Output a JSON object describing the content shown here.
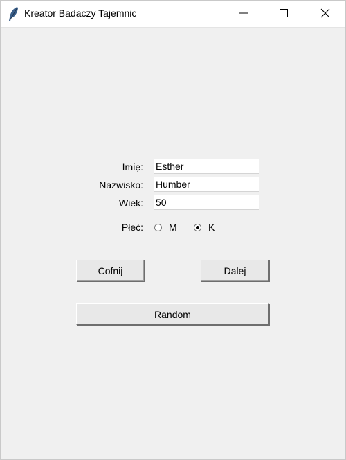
{
  "window": {
    "title": "Kreator Badaczy Tajemnic",
    "controls": {
      "minimize": "minimize",
      "maximize": "maximize",
      "close": "close"
    }
  },
  "form": {
    "first_name": {
      "label": "Imię:",
      "value": "Esther"
    },
    "last_name": {
      "label": "Nazwisko:",
      "value": "Humber"
    },
    "age": {
      "label": "Wiek:",
      "value": "50"
    },
    "sex": {
      "label": "Płeć:",
      "options": [
        {
          "label": "M",
          "selected": false
        },
        {
          "label": "K",
          "selected": true
        }
      ]
    }
  },
  "buttons": {
    "back": "Cofnij",
    "next": "Dalej",
    "random": "Random"
  },
  "icons": {
    "app": "feather-icon",
    "minimize": "minimize-icon",
    "maximize": "maximize-icon",
    "close": "close-icon"
  }
}
